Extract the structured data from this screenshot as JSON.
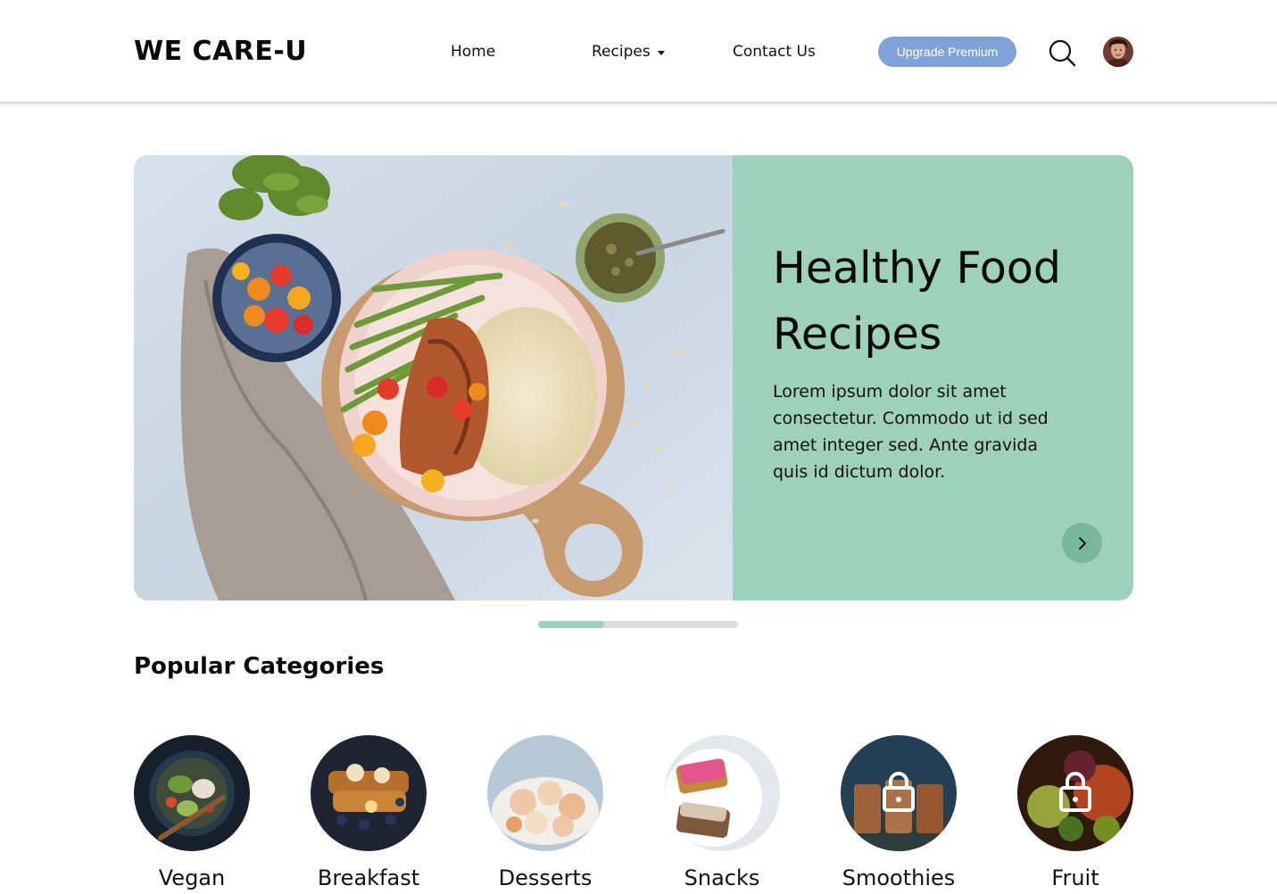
{
  "header": {
    "logo": "WE CARE-U",
    "nav": {
      "home": "Home",
      "recipes": "Recipes",
      "contact": "Contact Us"
    },
    "premium_label": "Upgrade Premium"
  },
  "hero": {
    "title": "Healthy Food Recipes",
    "text": "Lorem ipsum dolor sit amet consectetur. Commodo ut id sed amet integer sed. Ante gravida quis id dictum dolor."
  },
  "carousel": {
    "progress_fraction": 0.33
  },
  "categories": {
    "title": "Popular Categories",
    "items": [
      {
        "label": "Vegan",
        "locked": false
      },
      {
        "label": "Breakfast",
        "locked": false
      },
      {
        "label": "Desserts",
        "locked": false
      },
      {
        "label": "Snacks",
        "locked": false
      },
      {
        "label": "Smoothies",
        "locked": true
      },
      {
        "label": "Fruit",
        "locked": true
      }
    ]
  },
  "colors": {
    "accent_mint": "#9ed0bb",
    "premium_blue": "#7fa2d9"
  },
  "icons": {
    "search": "search-icon",
    "next": "chevron-right-icon",
    "lock": "lock-icon",
    "caret": "caret-down-icon"
  }
}
